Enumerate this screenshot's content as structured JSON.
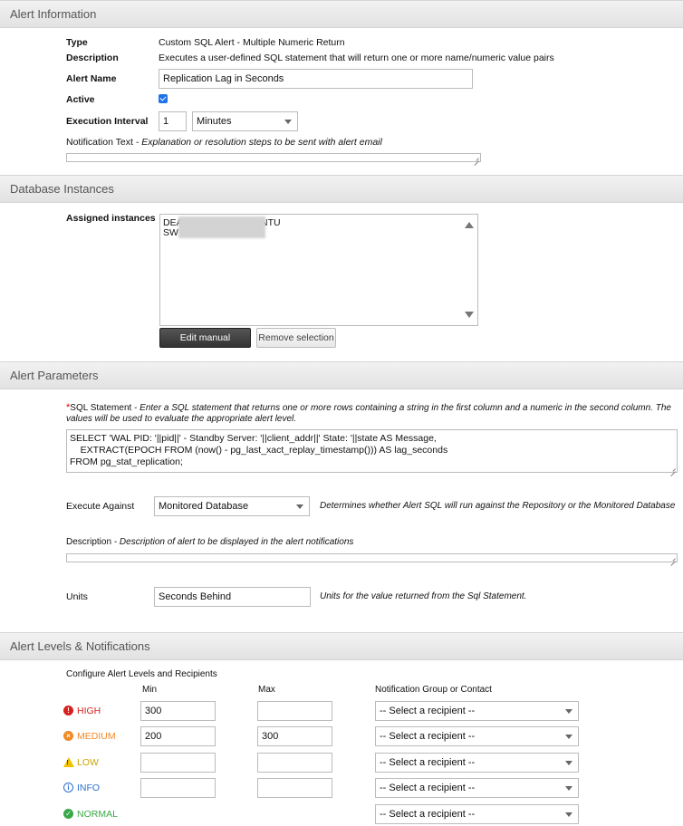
{
  "sections": {
    "alert_information": "Alert Information",
    "database_instances": "Database Instances",
    "alert_parameters": "Alert Parameters",
    "alert_levels": "Alert Levels & Notifications"
  },
  "alert_info": {
    "type_label": "Type",
    "type_value": "Custom SQL Alert - Multiple Numeric Return",
    "description_label": "Description",
    "description_value": "Executes a user-defined SQL statement that will return one or more name/numeric value pairs",
    "alert_name_label": "Alert Name",
    "alert_name_value": "Replication Lag in Seconds",
    "active_label": "Active",
    "active_checked": true,
    "interval_label": "Execution Interval",
    "interval_value": "1",
    "interval_unit": "Minutes",
    "notification_label": "Notification Text",
    "notification_hint": " - Explanation or resolution steps to be sent with alert email"
  },
  "db_instances": {
    "assigned_label": "Assigned instances",
    "instances": [
      "DEA",
      "SW"
    ],
    "instance_suffix": "NTU",
    "edit_button": "Edit manual selection",
    "remove_button": "Remove selection"
  },
  "parameters": {
    "required_mark": "*",
    "sql_label": "SQL Statement",
    "sql_hint": " - Enter a SQL statement that returns one or more rows containing a string in the first column and a numeric in the second column. The values will be used to evaluate the appropriate alert level.",
    "sql_lines": [
      "SELECT 'WAL PID: '||pid||' - Standby Server: '||client_addr||' State: '||state AS Message,",
      "    EXTRACT(EPOCH FROM (now() - pg_last_xact_replay_timestamp())) AS lag_seconds",
      "FROM pg_stat_replication;"
    ],
    "execute_against_label": "Execute Against",
    "execute_against_value": "Monitored Database",
    "execute_against_hint": "Determines whether Alert SQL will run against the Repository or the Monitored Database",
    "description_label": "Description",
    "description_hint": " - Description of alert to be displayed in the alert notifications",
    "units_label": "Units",
    "units_value": "Seconds Behind",
    "units_hint": "Units for the value returned from the Sql Statement."
  },
  "levels": {
    "configure_label": "Configure Alert Levels and Recipients",
    "col_min": "Min",
    "col_max": "Max",
    "col_recipient": "Notification Group or Contact",
    "rows": [
      {
        "name": "HIGH",
        "color": "#d9201e",
        "min": "300",
        "max": "",
        "recipient": "-- Select a recipient --",
        "icon": "!"
      },
      {
        "name": "MEDIUM",
        "color": "#f08a24",
        "min": "200",
        "max": "300",
        "recipient": "-- Select a recipient --",
        "icon": "×"
      },
      {
        "name": "LOW",
        "color": "#c9a400",
        "min": "",
        "max": "",
        "recipient": "-- Select a recipient --",
        "icon": "!"
      },
      {
        "name": "INFO",
        "color": "#2c6fd1",
        "min": "",
        "max": "",
        "recipient": "-- Select a recipient --",
        "icon": "i"
      },
      {
        "name": "NORMAL",
        "color": "#3aa84a",
        "min": "",
        "max": "",
        "recipient": "-- Select a recipient --",
        "icon": "✓"
      }
    ]
  }
}
